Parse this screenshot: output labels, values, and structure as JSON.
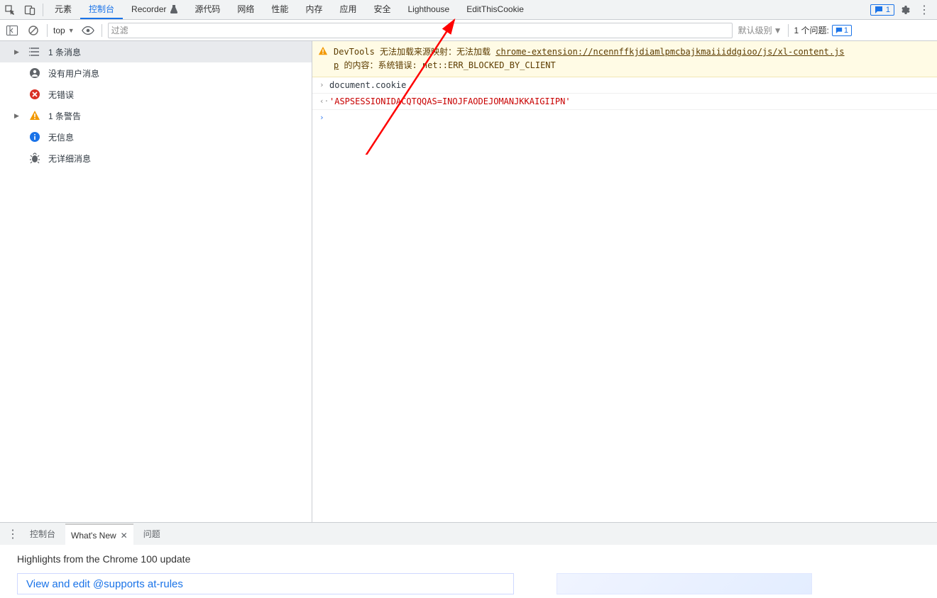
{
  "topbar": {
    "tabs": [
      "元素",
      "控制台",
      "Recorder",
      "源代码",
      "网络",
      "性能",
      "内存",
      "应用",
      "安全",
      "Lighthouse",
      "EditThisCookie"
    ],
    "active_index": 1,
    "error_badge": "1"
  },
  "toolbar": {
    "context": "top",
    "filter_placeholder": "过滤",
    "level_label": "默认级别",
    "issues_label": "1 个问题:",
    "issues_count": "1"
  },
  "sidebar": {
    "items": [
      {
        "expand": true,
        "icon": "list",
        "label": "1 条消息"
      },
      {
        "expand": false,
        "icon": "user",
        "label": "没有用户消息"
      },
      {
        "expand": false,
        "icon": "error",
        "label": "无错误"
      },
      {
        "expand": true,
        "icon": "warn",
        "label": "1 条警告"
      },
      {
        "expand": false,
        "icon": "info",
        "label": "无信息"
      },
      {
        "expand": false,
        "icon": "bug",
        "label": "无详细消息"
      }
    ]
  },
  "console": {
    "warning_prefix": "DevTools 无法加载来源映射：无法加载 ",
    "warning_link": "chrome-extension://ncennffkjdiamlpmcbajkmaiiiddgioo/js/xl-content.js",
    "warning_suffix1": "p",
    "warning_suffix2": " 的内容：系统错误: net::ERR_BLOCKED_BY_CLIENT",
    "input": "document.cookie",
    "output": "'ASPSESSIONIDACQTQQAS=INOJFAODEJOMANJKKAIGIIPN'"
  },
  "drawer": {
    "tabs": [
      "控制台",
      "What's New",
      "问题"
    ],
    "active_index": 1
  },
  "whatsnew": {
    "headline": "Highlights from the Chrome 100 update",
    "card_title": "View and edit @supports at-rules"
  }
}
